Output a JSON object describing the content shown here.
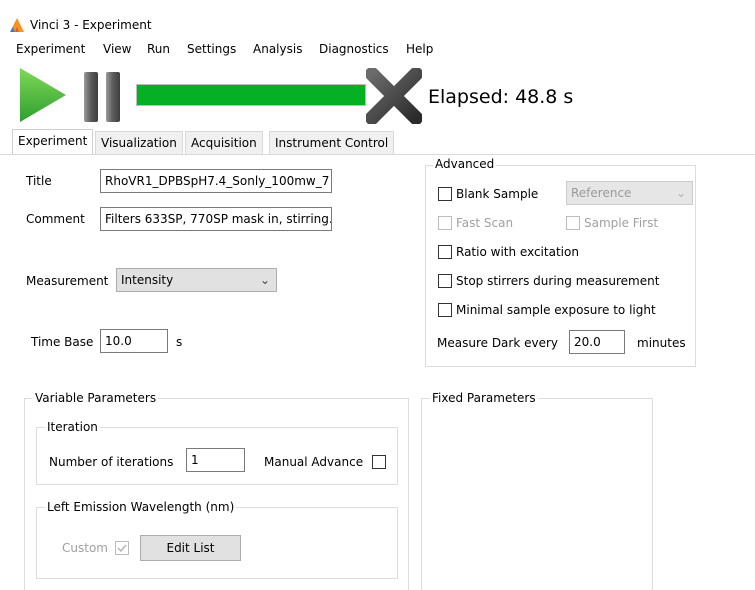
{
  "window": {
    "title": "Vinci 3 - Experiment",
    "app_icon": "vinci-logo-icon"
  },
  "menu": [
    "Experiment",
    "View",
    "Run",
    "Settings",
    "Analysis",
    "Diagnostics",
    "Help"
  ],
  "toolbar": {
    "play_icon": "play-icon",
    "pause_icon": "pause-icon",
    "stop_icon": "stop-x-icon",
    "progress_fraction": 1.0,
    "progress_color": "#06b025",
    "elapsed": "Elapsed: 48.8 s"
  },
  "tabs": [
    {
      "label": "Experiment",
      "active": true
    },
    {
      "label": "Visualization",
      "active": false
    },
    {
      "label": "Acquisition",
      "active": false
    },
    {
      "label": "Instrument Control",
      "active": false
    }
  ],
  "experiment": {
    "title_label": "Title",
    "title_value": "RhoVR1_DPBSpH7.4_Sonly_100mw_7",
    "comment_label": "Comment",
    "comment_value": "Filters 633SP, 770SP mask in, stirring.",
    "measurement_label": "Measurement",
    "measurement_value": "Intensity",
    "timebase_label": "Time Base",
    "timebase_value": "10.0",
    "timebase_unit": "s"
  },
  "advanced": {
    "title": "Advanced",
    "blank_sample": {
      "label": "Blank Sample",
      "checked": false
    },
    "reference_select": "Reference",
    "fast_scan": {
      "label": "Fast Scan",
      "checked": false,
      "enabled": false
    },
    "sample_first": {
      "label": "Sample First",
      "checked": false,
      "enabled": false
    },
    "ratio_excitation": {
      "label": "Ratio with excitation",
      "checked": false
    },
    "stop_stirrers": {
      "label": "Stop stirrers during measurement",
      "checked": false
    },
    "minimal_exposure": {
      "label": "Minimal sample exposure to light",
      "checked": false
    },
    "measure_dark_label": "Measure Dark every",
    "measure_dark_value": "20.0",
    "measure_dark_unit": "minutes"
  },
  "variable_params": {
    "title": "Variable Parameters",
    "iteration": {
      "title": "Iteration",
      "count_label": "Number of iterations",
      "count_value": "1",
      "manual_advance_label": "Manual Advance",
      "manual_advance_checked": false
    },
    "left_emission": {
      "title": "Left Emission Wavelength   (nm)",
      "custom_label": "Custom",
      "custom_checked": true,
      "edit_list_label": "Edit List"
    }
  },
  "fixed_params": {
    "title": "Fixed Parameters"
  }
}
